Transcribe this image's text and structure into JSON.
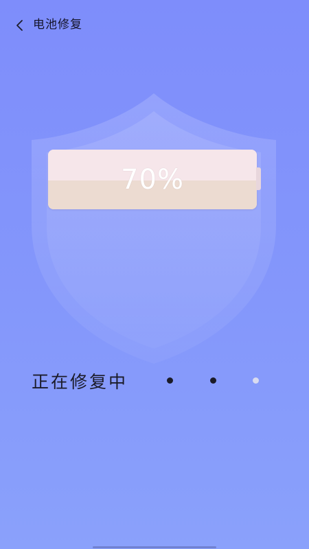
{
  "header": {
    "back_icon": "chevron-left-icon",
    "title": "电池修复"
  },
  "battery": {
    "level_percent": 70,
    "label": "70%"
  },
  "status": {
    "text": "正在修复中",
    "dots_active": 2,
    "dots_total": 3
  },
  "colors": {
    "background_top": "#7e8dfb",
    "background_bottom": "#8aa1fb",
    "battery_fill": "#ecdbd1",
    "text_dark": "#1b1b28"
  }
}
